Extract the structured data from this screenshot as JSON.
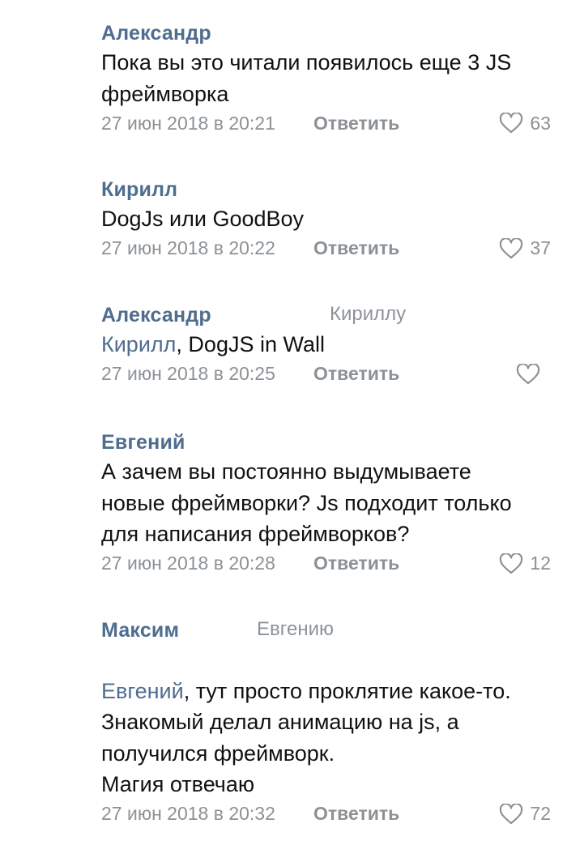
{
  "reply_label": "Ответить",
  "comments": [
    {
      "author": "Александр",
      "reply_to": "",
      "mention": "",
      "text": "Пока вы это читали появилось еще 3 JS фреймворка",
      "date": "27 июн 2018 в 20:21",
      "likes": "63"
    },
    {
      "author": "Кирилл",
      "reply_to": "",
      "mention": "",
      "text": "DogJs или GoodBoy",
      "date": "27 июн 2018 в 20:22",
      "likes": "37"
    },
    {
      "author": "Александр",
      "reply_to": "Кириллу",
      "mention": "Кирилл",
      "text": ", DogJS in Wall",
      "date": "27 июн 2018 в 20:25",
      "likes": ""
    },
    {
      "author": "Евгений",
      "reply_to": "",
      "mention": "",
      "text": "А зачем вы постоянно выдумываете новые фреймворки? Js подходит только для написания фреймворков?",
      "date": "27 июн 2018 в 20:28",
      "likes": "12"
    },
    {
      "author": "Максим",
      "reply_to": "Евгению",
      "mention": "Евгений",
      "text": ", тут просто проклятие какое-то.\nЗнакомый делал анимацию на js, а получился фреймворк.\nМагия отвечаю",
      "date": "27 июн 2018 в 20:32",
      "likes": "72"
    }
  ],
  "colors": {
    "author": "#4f6d8f",
    "meta": "#8c9196",
    "text": "#111111"
  },
  "icons": {
    "like": "heart-icon"
  }
}
